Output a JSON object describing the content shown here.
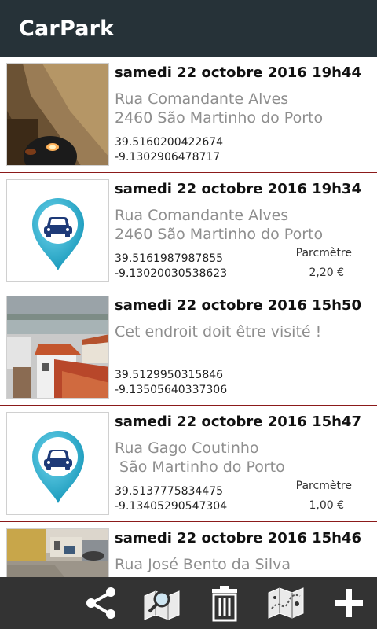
{
  "app": {
    "title": "CarPark"
  },
  "entries": [
    {
      "date": "samedi 22 octobre 2016 19h44",
      "address": "Rua Comandante Alves\n2460 São Martinho do Porto",
      "lat": "39.5160200422674",
      "lon": "-9.1302906478717",
      "thumbnail": "photo-street-night",
      "payment_label": "",
      "payment_value": ""
    },
    {
      "date": "samedi 22 octobre 2016 19h34",
      "address": "Rua Comandante Alves\n2460 São Martinho do Porto",
      "lat": "39.5161987987855",
      "lon": "-9.13020030538623",
      "thumbnail": "car-pin-icon",
      "payment_label": "Parcmètre",
      "payment_value": "2,20 €"
    },
    {
      "date": "samedi 22 octobre 2016 15h50",
      "address": "Cet endroit doit être visité !",
      "lat": "39.5129950315846",
      "lon": "-9.13505640337306",
      "thumbnail": "photo-rooftops-bay",
      "payment_label": "",
      "payment_value": ""
    },
    {
      "date": "samedi 22 octobre 2016 15h47",
      "address": "Rua Gago Coutinho\n São Martinho do Porto",
      "lat": "39.5137775834475",
      "lon": "-9.13405290547304",
      "thumbnail": "car-pin-icon",
      "payment_label": "Parcmètre",
      "payment_value": "1,00 €"
    },
    {
      "date": "samedi 22 octobre 2016 15h46",
      "address": "Rua José Bento da Silva",
      "lat": "",
      "lon": "",
      "thumbnail": "photo-cobbled-street",
      "payment_label": "",
      "payment_value": ""
    }
  ],
  "bottom_bar": {
    "actions": [
      "share-icon",
      "map-search-icon",
      "trash-icon",
      "map-icon",
      "add-icon"
    ]
  },
  "colors": {
    "appbar": "#263238",
    "bottom_bar": "#333333",
    "separator": "#8b1a1a",
    "pin": "#29b6d6",
    "car": "#1e3a78"
  }
}
